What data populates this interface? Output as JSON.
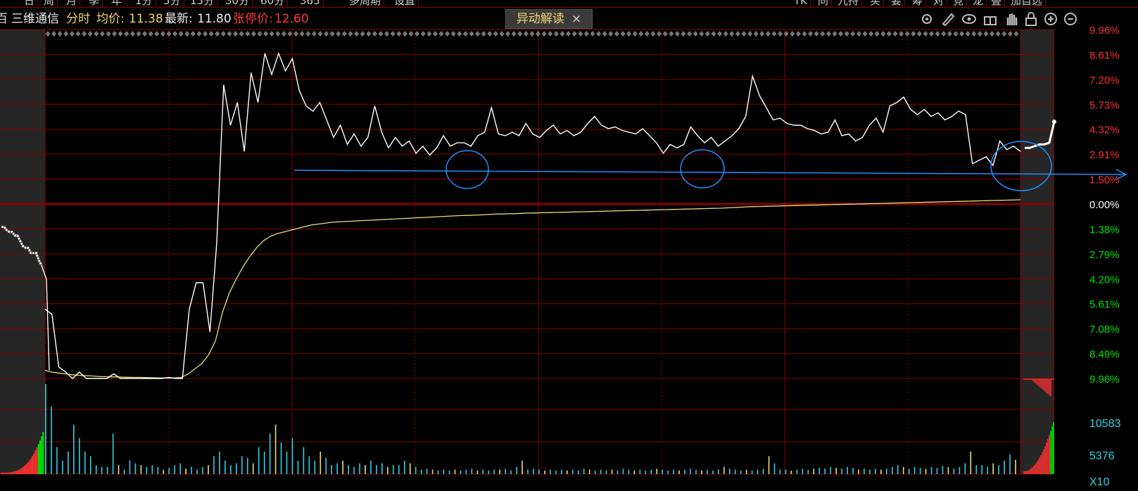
{
  "top_tabs": [
    {
      "label": "日"
    },
    {
      "label": "周"
    },
    {
      "label": "月"
    },
    {
      "label": "季"
    },
    {
      "label": "年"
    },
    {
      "label": "1分"
    },
    {
      "label": "5分"
    },
    {
      "label": "15分"
    },
    {
      "label": "30分"
    },
    {
      "label": "60分"
    },
    {
      "label": "365"
    },
    {
      "label": "多周期"
    },
    {
      "label": "设置"
    }
  ],
  "top_right_tabs": [
    {
      "label": "TK"
    },
    {
      "label": "同"
    },
    {
      "label": "九持"
    },
    {
      "label": "买"
    },
    {
      "label": "要"
    },
    {
      "label": "筹"
    },
    {
      "label": "对"
    },
    {
      "label": "竞"
    },
    {
      "label": "龙"
    },
    {
      "label": "叠"
    },
    {
      "label": "加自选"
    }
  ],
  "info": {
    "stock_name": "三维通信",
    "mode": "分时",
    "avg_label": "均价:",
    "avg_value": "11.38",
    "latest_label": "最新:",
    "latest_value": "11.80",
    "limit_label": "张停价:",
    "limit_value": "12.60"
  },
  "popup": {
    "label": "异动解读",
    "close": "×"
  },
  "tool_icons": [
    "gear-icon",
    "pen-icon",
    "eye-icon",
    "gift-icon",
    "hand-icon",
    "lock-icon",
    "zoom-in-icon",
    "zoom-out-icon"
  ],
  "colors": {
    "price_line": "#ffffff",
    "avg_line": "#e6e07a",
    "grid": "#8a0000",
    "up": "#ff3030",
    "flat": "#ffffff",
    "down": "#00e600",
    "volume_cyan": "#2ad4e8",
    "volume_yellow": "#e8e07a",
    "annotation": "#1e8fff"
  },
  "chart_data": {
    "type": "line",
    "title": "",
    "y_right_labels_up": [
      "9.96%",
      "8.61%",
      "7.20%",
      "5.73%",
      "4.32%",
      "2.91%",
      "1.50%",
      "0.00%"
    ],
    "y_right_labels_down": [
      "1.38%",
      "2.79%",
      "4.20%",
      "5.61%",
      "7.08%",
      "8.49%",
      "9.96%"
    ],
    "volume_labels": [
      "10583",
      "5376",
      "X10"
    ],
    "ylim_pct": [
      -9.96,
      9.96
    ],
    "price_pct": [
      -6.0,
      -6.3,
      -9.3,
      -9.6,
      -9.96,
      -9.6,
      -9.96,
      -9.96,
      -9.96,
      -9.96,
      -9.7,
      -9.96,
      -9.96,
      -9.96,
      -9.96,
      -9.96,
      -9.96,
      -9.96,
      -9.9,
      -9.96,
      -9.96,
      -6.0,
      -4.5,
      -4.5,
      -7.3,
      -2.2,
      6.8,
      4.5,
      5.8,
      3.0,
      7.5,
      5.8,
      8.6,
      7.4,
      8.6,
      7.6,
      8.3,
      6.5,
      5.6,
      5.3,
      5.8,
      4.8,
      3.8,
      4.5,
      3.4,
      4.0,
      3.3,
      3.8,
      5.6,
      4.1,
      3.2,
      3.8,
      3.3,
      3.6,
      2.9,
      3.3,
      2.8,
      3.2,
      3.9,
      3.3,
      3.5,
      3.5,
      3.3,
      3.9,
      4.1,
      5.5,
      4.0,
      3.9,
      4.1,
      3.9,
      4.6,
      4.0,
      3.8,
      4.2,
      4.5,
      4.0,
      4.2,
      3.9,
      4.1,
      4.6,
      5.0,
      4.5,
      4.3,
      4.4,
      4.2,
      4.1,
      4.0,
      4.3,
      3.9,
      3.5,
      2.9,
      3.4,
      3.2,
      3.4,
      4.4,
      3.9,
      3.5,
      3.8,
      3.3,
      3.6,
      3.9,
      4.3,
      5.0,
      7.3,
      6.2,
      5.5,
      4.8,
      4.9,
      4.6,
      4.5,
      4.5,
      4.3,
      4.2,
      4.0,
      4.1,
      4.8,
      3.9,
      4.0,
      3.6,
      3.8,
      4.5,
      4.9,
      4.1,
      5.6,
      5.8,
      6.1,
      5.4,
      5.1,
      5.4,
      5.0,
      5.2,
      4.8,
      5.0,
      5.3,
      5.1,
      2.3,
      2.5,
      2.7,
      2.2,
      3.6,
      3.1,
      3.3,
      3.0
    ],
    "after_close_pct": [
      3.2,
      3.2,
      3.3,
      3.4,
      3.4,
      3.5,
      4.7
    ],
    "avg_pct": [
      -9.5,
      -9.6,
      -9.65,
      -9.7,
      -9.75,
      -9.78,
      -9.8,
      -9.82,
      -9.85,
      -9.86,
      -9.87,
      -9.88,
      -9.89,
      -9.9,
      -9.9,
      -9.91,
      -9.92,
      -9.93,
      -9.93,
      -9.93,
      -9.9,
      -9.7,
      -9.4,
      -9.1,
      -8.6,
      -7.8,
      -6.2,
      -5.1,
      -4.3,
      -3.6,
      -3.0,
      -2.5,
      -2.1,
      -1.85,
      -1.7,
      -1.6,
      -1.5,
      -1.4,
      -1.3,
      -1.2,
      -1.15,
      -1.1,
      -1.05,
      -1.02,
      -1.0,
      -0.98,
      -0.96,
      -0.94,
      -0.92,
      -0.9,
      -0.88,
      -0.86,
      -0.84,
      -0.82,
      -0.8,
      -0.78,
      -0.76,
      -0.74,
      -0.72,
      -0.7,
      -0.68,
      -0.66,
      -0.65,
      -0.64,
      -0.62,
      -0.6,
      -0.58,
      -0.57,
      -0.56,
      -0.55,
      -0.53,
      -0.52,
      -0.51,
      -0.5,
      -0.49,
      -0.48,
      -0.47,
      -0.46,
      -0.45,
      -0.44,
      -0.43,
      -0.42,
      -0.41,
      -0.4,
      -0.39,
      -0.38,
      -0.37,
      -0.36,
      -0.35,
      -0.34,
      -0.33,
      -0.32,
      -0.31,
      -0.3,
      -0.29,
      -0.28,
      -0.27,
      -0.26,
      -0.25,
      -0.24,
      -0.22,
      -0.2,
      -0.18,
      -0.16,
      -0.15,
      -0.14,
      -0.13,
      -0.12,
      -0.11,
      -0.1,
      -0.09,
      -0.08,
      -0.07,
      -0.06,
      -0.05,
      -0.04,
      -0.03,
      -0.02,
      -0.01,
      0.0,
      0.01,
      0.02,
      0.03,
      0.04,
      0.05,
      0.06,
      0.07,
      0.08,
      0.09,
      0.1,
      0.11,
      0.12,
      0.13,
      0.14,
      0.15,
      0.16,
      0.17,
      0.18,
      0.19,
      0.2,
      0.21,
      0.22,
      0.23,
      0.24
    ],
    "pre_open_pct": [
      -1.3,
      -1.3,
      -1.5,
      -1.6,
      -1.6,
      -1.8,
      -1.8,
      -2.1,
      -2.4,
      -2.5,
      -2.5,
      -2.8,
      -2.8,
      -2.8,
      -3.2,
      -3.5
    ],
    "volume": [
      1.0,
      0.75,
      0.3,
      0.15,
      0.25,
      0.55,
      0.4,
      0.25,
      0.2,
      0.1,
      0.08,
      0.08,
      0.45,
      0.1,
      0.05,
      0.15,
      0.12,
      0.1,
      0.08,
      0.1,
      0.08,
      0.05,
      0.07,
      0.1,
      0.12,
      0.06,
      0.08,
      0.05,
      0.08,
      0.1,
      0.2,
      0.25,
      0.15,
      0.1,
      0.12,
      0.2,
      0.18,
      0.12,
      0.3,
      0.25,
      0.45,
      0.55,
      0.35,
      0.25,
      0.4,
      0.15,
      0.3,
      0.2,
      0.15,
      0.25,
      0.18,
      0.1,
      0.12,
      0.15,
      0.1,
      0.08,
      0.12,
      0.1,
      0.15,
      0.1,
      0.12,
      0.08,
      0.1,
      0.1,
      0.15,
      0.12,
      0.08,
      0.05,
      0.06,
      0.05,
      0.04,
      0.05,
      0.04,
      0.05,
      0.04,
      0.05,
      0.06,
      0.04,
      0.05,
      0.04,
      0.05,
      0.05,
      0.06,
      0.04,
      0.08,
      0.15,
      0.05,
      0.06,
      0.05,
      0.04,
      0.05,
      0.04,
      0.05,
      0.04,
      0.05,
      0.04,
      0.06,
      0.05,
      0.04,
      0.05,
      0.04,
      0.05,
      0.04,
      0.06,
      0.05,
      0.04,
      0.05,
      0.04,
      0.05,
      0.06,
      0.05,
      0.04,
      0.05,
      0.04,
      0.05,
      0.06,
      0.05,
      0.04,
      0.05,
      0.04,
      0.05,
      0.08,
      0.06,
      0.05,
      0.04,
      0.05,
      0.04,
      0.05,
      0.06,
      0.2,
      0.12,
      0.05,
      0.05,
      0.04,
      0.05,
      0.06,
      0.05,
      0.06,
      0.07,
      0.06,
      0.08,
      0.07,
      0.06,
      0.08,
      0.07,
      0.05,
      0.06,
      0.05,
      0.06,
      0.05,
      0.06,
      0.08,
      0.1,
      0.08,
      0.06,
      0.08,
      0.07,
      0.06,
      0.08,
      0.07,
      0.09,
      0.08,
      0.06,
      0.08,
      0.12,
      0.25,
      0.1,
      0.1,
      0.08,
      0.12,
      0.1,
      0.15,
      0.22,
      0.16
    ]
  }
}
